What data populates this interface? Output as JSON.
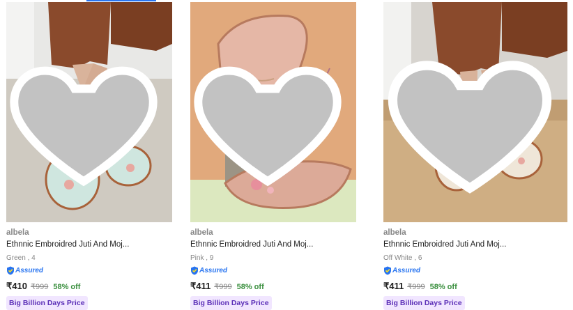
{
  "products": [
    {
      "brand": "albela",
      "title": "Ethnnic Embroidred Juti And Moj...",
      "variant": "Green , 4",
      "assured_label": "Assured",
      "price": "₹410",
      "mrp": "₹999",
      "discount": "58% off",
      "offer_badge": "Big Billion Days Price"
    },
    {
      "brand": "albela",
      "title": "Ethnnic Embroidred Juti And Moj...",
      "variant": "Pink , 9",
      "assured_label": "Assured",
      "price": "₹411",
      "mrp": "₹999",
      "discount": "58% off",
      "offer_badge": "Big Billion Days Price"
    },
    {
      "brand": "albela",
      "title": "Ethnnic Embroidred Juti And Moj...",
      "variant": "Off White , 6",
      "assured_label": "Assured",
      "price": "₹411",
      "mrp": "₹999",
      "discount": "58% off",
      "offer_badge": "Big Billion Days Price"
    }
  ],
  "colors": {
    "discount": "#388e3c",
    "assured": "#2874f0",
    "badge_bg": "#f1e6ff",
    "badge_text": "#5b2fb7"
  },
  "icons": [
    "heart-icon",
    "assured-badge-icon"
  ]
}
